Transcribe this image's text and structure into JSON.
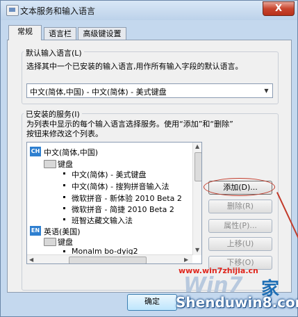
{
  "window": {
    "title": "文本服务和输入语言",
    "close_label": "X"
  },
  "tabs": [
    "常规",
    "语言栏",
    "高级键设置"
  ],
  "default_input": {
    "label": "默认输入语言(L)",
    "description": "选择其中一个已安装的输入语言,用作所有输入字段的默认语言。",
    "selected": "中文(简体,中国) - 中文(简体) - 美式键盘"
  },
  "installed": {
    "label": "已安装的服务(I)",
    "description_line1": "为列表中显示的每个输入语言选择服务。使用“添加”和“删除”",
    "description_line2": "按钮来修改这个列表。",
    "tree": {
      "lang1": {
        "icon": "CH",
        "name": "中文(简体,中国)"
      },
      "group1": "键盘",
      "items1": [
        "中文(简体) - 美式键盘",
        "中文(简体) - 搜狗拼音输入法",
        "微软拼音 - 新体验 2010 Beta 2",
        "微软拼音 - 简捷 2010 Beta 2",
        "班智达藏文输入法"
      ],
      "lang2": {
        "icon": "EN",
        "name": "英语(美国)"
      },
      "group2": "键盘",
      "items2": [
        "Monalm bo-dyig2"
      ]
    }
  },
  "buttons": {
    "add": "添加(D)...",
    "remove": "删除(R)",
    "properties": "属性(P)...",
    "move_up": "上移(U)",
    "move_down": "下移(O)"
  },
  "footer": {
    "ok": "确定"
  },
  "watermarks": {
    "site": "www.win7zhijia.cn",
    "brand_left": "Win7",
    "brand_right": "家",
    "shendu": "Shenduwin8.com"
  },
  "colors": {
    "annotation": "#c23a2a",
    "accent": "#2e7fd0"
  }
}
